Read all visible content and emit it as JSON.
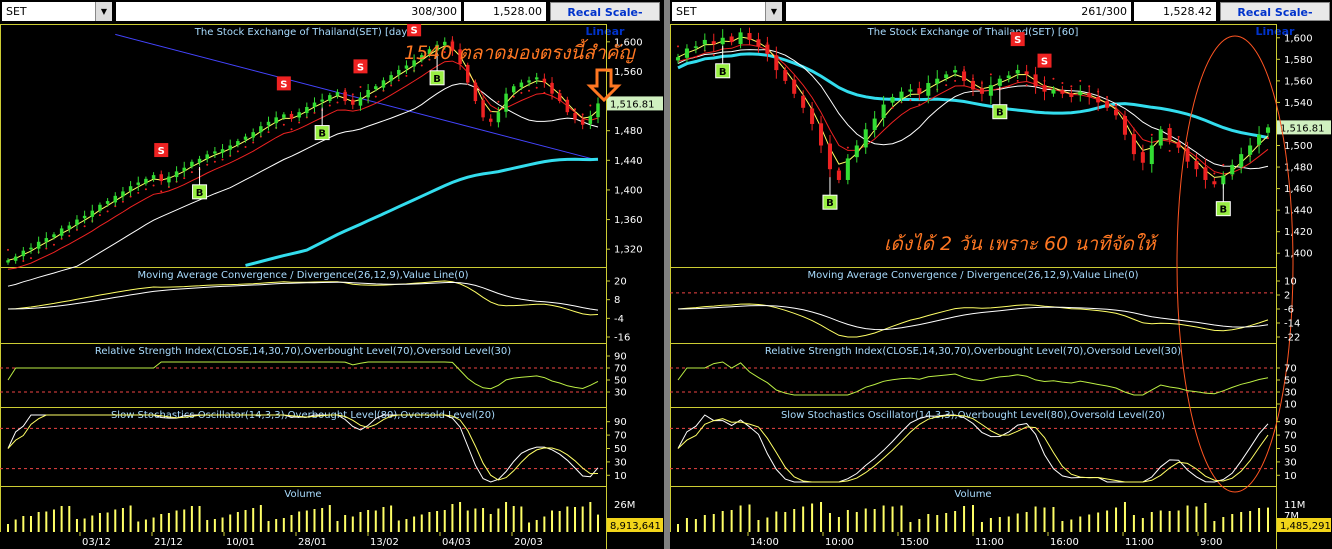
{
  "left": {
    "ticker": "SET",
    "count": "308/300",
    "last": "1,528.00",
    "recal": "Recal Scale-Linear",
    "title": "The Stock Exchange of Thailand(SET) [day]",
    "annotation": "1540 ตลาดมองตรงนี้สำคัญ",
    "price_tag": "1,516.81",
    "volume_tag": "8,913,641",
    "y_ticks": [
      "1,600",
      "1,560",
      "1,520",
      "1,480",
      "1,440",
      "1,400",
      "1,360",
      "1,320"
    ],
    "macd_ticks": [
      "20",
      "8",
      "-4",
      "-16"
    ],
    "rsi_ticks": [
      "90",
      "70",
      "50",
      "30"
    ],
    "sto_ticks": [
      "90",
      "70",
      "50",
      "30",
      "10"
    ],
    "vol_ticks": [
      "26M"
    ],
    "x_ticks": [
      "03/12",
      "21/12",
      "10/01",
      "28/01",
      "13/02",
      "04/03",
      "20/03"
    ]
  },
  "right": {
    "ticker": "SET",
    "count": "261/300",
    "last": "1,528.42",
    "recal": "Recal Scale-Linear",
    "title": "The Stock Exchange of Thailand(SET) [60]",
    "annotation": "เด้งได้ 2 วัน เพราะ 60 นาทีจัดให้",
    "price_tag": "1,516.81",
    "volume_tag": "1,485,291",
    "y_ticks": [
      "1,600",
      "1,580",
      "1,560",
      "1,540",
      "1,520",
      "1,500",
      "1,480",
      "1,460",
      "1,440",
      "1,420",
      "1,400"
    ],
    "macd_ticks": [
      "10",
      "2",
      "-6",
      "-14",
      "-22"
    ],
    "rsi_ticks": [
      "70",
      "50",
      "30",
      "10"
    ],
    "sto_ticks": [
      "90",
      "70",
      "50",
      "30",
      "10"
    ],
    "vol_ticks": [
      "11M",
      "7M",
      "3M"
    ],
    "x_ticks": [
      "14:00",
      "10:00",
      "15:00",
      "11:00",
      "16:00",
      "11:00",
      "9:00"
    ]
  },
  "panels": {
    "macd": "Moving Average Convergence / Divergence(26,12,9),Value Line(0)",
    "rsi": "Relative Strength Index(CLOSE,14,30,70),Overbought Level(70),Oversold Level(30)",
    "sto": "Slow Stochastics Oscillator(14,3,3),Overbought Level(80),Oversold Level(20)",
    "volume": "Volume"
  },
  "signals": {
    "sell": "S",
    "buy": "B"
  },
  "colors": {
    "up": "#33dd33",
    "down": "#ee2222",
    "sma_fast": "#ffff66",
    "sma_mid": "#ee2222",
    "sma_slow": "#ffffff",
    "sma_long": "#33ddee",
    "trend": "#4444ff",
    "axis": "#cccc33",
    "annotation": "#ff7722"
  },
  "chart_data": [
    {
      "type": "line",
      "title": "The Stock Exchange of Thailand(SET) [day]",
      "timeframe": "day",
      "x_labels": [
        "03/12",
        "21/12",
        "10/01",
        "28/01",
        "13/02",
        "04/03",
        "20/03"
      ],
      "ylim": [
        1300,
        1620
      ],
      "close_series": [
        1305,
        1310,
        1318,
        1322,
        1330,
        1335,
        1340,
        1348,
        1352,
        1360,
        1365,
        1372,
        1380,
        1385,
        1392,
        1398,
        1405,
        1410,
        1415,
        1420,
        1412,
        1418,
        1425,
        1430,
        1438,
        1442,
        1448,
        1452,
        1455,
        1460,
        1466,
        1472,
        1478,
        1486,
        1492,
        1498,
        1502,
        1496,
        1505,
        1512,
        1518,
        1522,
        1528,
        1532,
        1520,
        1515,
        1525,
        1535,
        1540,
        1548,
        1555,
        1562,
        1568,
        1575,
        1582,
        1590,
        1596,
        1600,
        1588,
        1570,
        1545,
        1520,
        1498,
        1492,
        1505,
        1530,
        1540,
        1545,
        1548,
        1552,
        1545,
        1530,
        1520,
        1505,
        1495,
        1488,
        1500,
        1516.81
      ],
      "last_price": 1516.81,
      "annotation": "1540 ตลาดมองตรงนี้สำคัญ"
    },
    {
      "type": "line",
      "title": "The Stock Exchange of Thailand(SET) [60]",
      "timeframe": "60",
      "x_labels": [
        "14:00",
        "10:00",
        "15:00",
        "11:00",
        "16:00",
        "11:00",
        "9:00"
      ],
      "ylim": [
        1390,
        1610
      ],
      "close_series": [
        1582,
        1590,
        1592,
        1598,
        1594,
        1600,
        1596,
        1605,
        1598,
        1592,
        1585,
        1570,
        1560,
        1548,
        1535,
        1520,
        1500,
        1478,
        1468,
        1488,
        1500,
        1515,
        1525,
        1538,
        1545,
        1550,
        1552,
        1548,
        1558,
        1562,
        1566,
        1570,
        1560,
        1552,
        1548,
        1556,
        1562,
        1565,
        1570,
        1566,
        1555,
        1550,
        1552,
        1548,
        1545,
        1550,
        1545,
        1540,
        1535,
        1528,
        1510,
        1492,
        1484,
        1500,
        1515,
        1505,
        1498,
        1485,
        1478,
        1468,
        1464,
        1472,
        1482,
        1492,
        1500,
        1510,
        1516.81
      ],
      "last_price": 1516.81,
      "annotation": "เด้งได้ 2 วัน เพราะ 60 นาทีจัดให้"
    }
  ]
}
